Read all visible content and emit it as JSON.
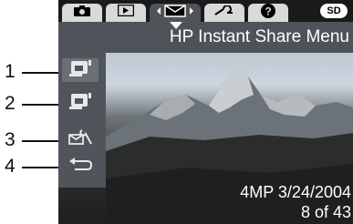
{
  "callouts": [
    "1",
    "2",
    "3",
    "4"
  ],
  "tabs": [
    {
      "icon": "camera-icon"
    },
    {
      "icon": "playback-icon"
    },
    {
      "icon": "share-envelope-icon",
      "active": true
    },
    {
      "icon": "setup-wrench-icon"
    },
    {
      "icon": "help-icon"
    }
  ],
  "sd_badge": "SD",
  "menu": {
    "title": "HP Instant Share Menu",
    "items": [
      {
        "icon": "printer-icon"
      },
      {
        "icon": "printer-icon"
      },
      {
        "icon": "envelope-wrench-icon"
      },
      {
        "icon": "return-arrow-icon"
      }
    ]
  },
  "status": {
    "info": "4MP  3/24/2004",
    "count": "8 of 43"
  },
  "colors": {
    "tab_active": "#4e5359",
    "tab_inactive": "#d9d9d9",
    "menu_panel": "#50555b",
    "text": "#ffffff"
  }
}
